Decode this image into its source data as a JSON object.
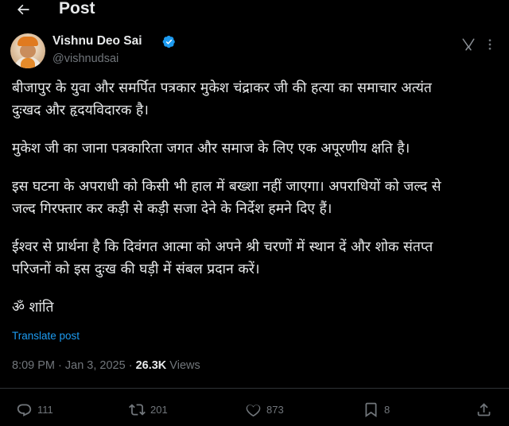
{
  "header": {
    "title": "Post",
    "back_icon": "arrow-left-icon"
  },
  "author": {
    "display_name": "Vishnu Deo Sai",
    "handle": "@vishnudsai",
    "verified": true,
    "verified_color": "#1d9bf0"
  },
  "post": {
    "paragraphs": [
      "बीजापुर के युवा और समर्पित पत्रकार मुकेश चंद्राकर जी की हत्या का समाचार अत्यंत\nदुःखद और हृदयविदारक है।",
      "मुकेश जी का जाना पत्रकारिता जगत और समाज के लिए एक अपूरणीय क्षति है।",
      "इस घटना के अपराधी को किसी भी हाल में बख्शा नहीं जाएगा। अपराधियों को जल्द से\nजल्द गिरफ्तार कर कड़ी से कड़ी सजा देने के निर्देश हमने दिए हैं।",
      "ईश्वर से प्रार्थना है कि दिवंगत आत्मा को अपने श्री चरणों में स्थान दें और शोक संतप्त\nपरिजनों को इस दुःख की घड़ी में संबल प्रदान करें।",
      "ॐ शांति"
    ],
    "translate_label": "Translate post",
    "time": "8:09 PM",
    "separator": " · ",
    "date": "Jan 3, 2025",
    "views_count": "26.3K",
    "views_label": " Views"
  },
  "actions": {
    "replies": "111",
    "reposts": "201",
    "likes": "873",
    "bookmarks": "8"
  },
  "colors": {
    "accent": "#1d9bf0",
    "muted": "#71767b",
    "text": "#e7e9ea",
    "background": "#000000",
    "divider": "#2f3336"
  }
}
